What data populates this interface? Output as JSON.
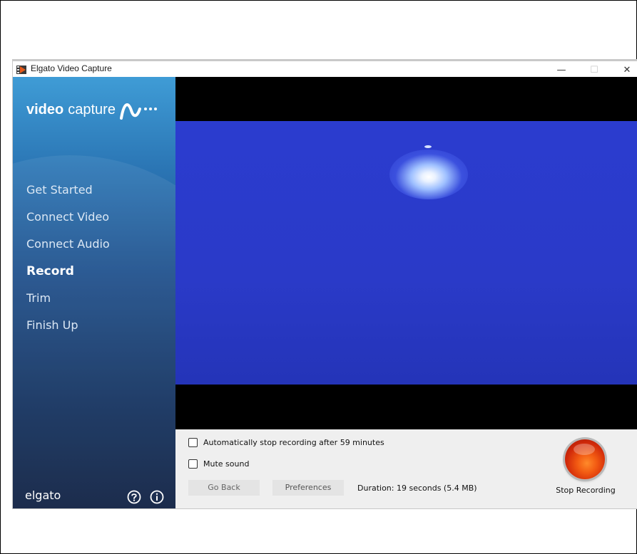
{
  "window": {
    "title": "Elgato Video Capture",
    "controls": {
      "minimize": "—",
      "maximize": "☐",
      "close": "✕"
    }
  },
  "sidebar": {
    "logo_strong": "video",
    "logo_light": "capture",
    "nav_items": [
      {
        "label": "Get Started",
        "active": false
      },
      {
        "label": "Connect Video",
        "active": false
      },
      {
        "label": "Connect Audio",
        "active": false
      },
      {
        "label": "Record",
        "active": true
      },
      {
        "label": "Trim",
        "active": false
      },
      {
        "label": "Finish Up",
        "active": false
      }
    ],
    "brand": "elgato",
    "icons": [
      "help-icon",
      "info-icon"
    ]
  },
  "controls": {
    "auto_stop_label": "Automatically stop recording after 59 minutes",
    "auto_stop_checked": false,
    "mute_label": "Mute sound",
    "mute_checked": false,
    "go_back_label": "Go Back",
    "preferences_label": "Preferences",
    "duration": "Duration: 19 seconds (5.4 MB)",
    "stop_recording_label": "Stop Recording"
  },
  "colors": {
    "sidebar_top": "#3f9cd6",
    "sidebar_bottom": "#0b1d3f",
    "video_blue": "#2b3ccf",
    "record_red": "#d12a0a"
  }
}
